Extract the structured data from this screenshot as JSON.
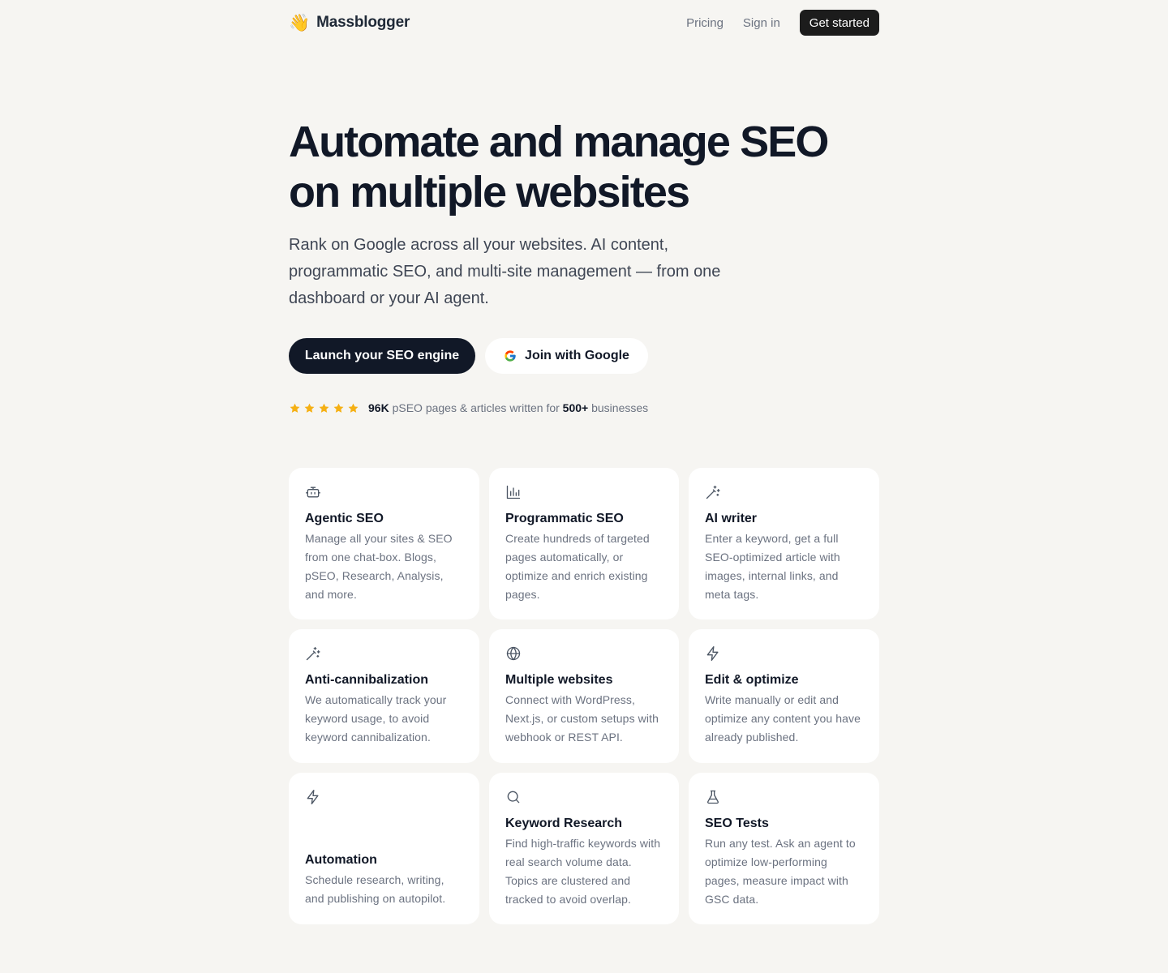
{
  "header": {
    "brand_emoji": "👋",
    "brand_name": "Massblogger",
    "nav": {
      "pricing": "Pricing",
      "sign_in": "Sign in",
      "get_started": "Get started"
    }
  },
  "hero": {
    "title_line1": "Automate and manage SEO",
    "title_line2": "on multiple websites",
    "subtitle": "Rank on Google across all your websites. AI content, programmatic SEO, and multi-site management — from one dashboard or your AI agent.",
    "primary_cta": "Launch your SEO engine",
    "google_cta": "Join with Google",
    "rating_stars": 5,
    "proof": {
      "count": "96K",
      "middle": " pSEO pages & articles written for ",
      "businesses_count": "500+",
      "end": " businesses"
    }
  },
  "features": [
    {
      "icon": "bot-icon",
      "title": "Agentic SEO",
      "description": "Manage all your sites & SEO from one chat-box. Blogs, pSEO, Research, Analysis, and more."
    },
    {
      "icon": "bar-chart-icon",
      "title": "Programmatic SEO",
      "description": "Create hundreds of targeted pages automatically, or optimize and enrich existing pages."
    },
    {
      "icon": "magic-wand-icon",
      "title": "AI writer",
      "description": "Enter a keyword, get a full SEO-optimized article with images, internal links, and meta tags."
    },
    {
      "icon": "magic-wand-icon",
      "title": "Anti-cannibalization",
      "description": "We automatically track your keyword usage, to avoid keyword cannibalization."
    },
    {
      "icon": "globe-icon",
      "title": "Multiple websites",
      "description": "Connect with WordPress, Next.js, or custom setups with webhook or REST API."
    },
    {
      "icon": "lightning-icon",
      "title": "Edit & optimize",
      "description": "Write manually or edit and optimize any content you have already published."
    },
    {
      "icon": "lightning-icon",
      "title": "Automation",
      "description": "Schedule research, writing, and publishing on autopilot."
    },
    {
      "icon": "search-icon",
      "title": "Keyword Research",
      "description": "Find high-traffic keywords with real search volume data. Topics are clustered and tracked to avoid overlap."
    },
    {
      "icon": "flask-icon",
      "title": "SEO Tests",
      "description": "Run any test. Ask an agent to optimize low-performing pages, measure impact with GSC data."
    }
  ],
  "colors": {
    "background": "#f6f5f2",
    "primary_dark": "#111827",
    "star": "#f5b014",
    "muted_text": "#6b7280",
    "icon": "#4b5563"
  }
}
